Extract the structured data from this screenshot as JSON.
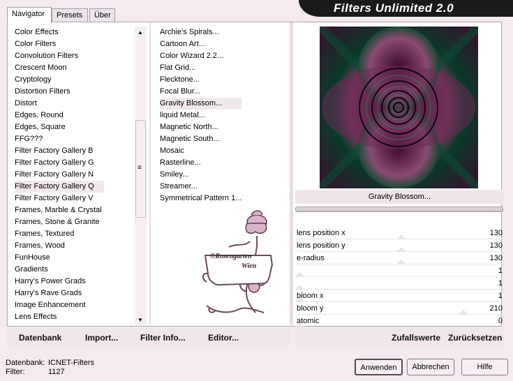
{
  "tabs": [
    {
      "label": "Navigator",
      "active": true
    },
    {
      "label": "Presets",
      "active": false
    },
    {
      "label": "Über",
      "active": false
    }
  ],
  "app_title": "Filters Unlimited 2.0",
  "categories": [
    "Color Effects",
    "Color Filters",
    "Convolution Filters",
    "Crescent Moon",
    "Cryptology",
    "Distortion Filters",
    "Distort",
    "Edges, Round",
    "Edges, Square",
    "FFG???",
    "Filter Factory Gallery B",
    "Filter Factory Gallery G",
    "Filter Factory Gallery N",
    "Filter Factory Gallery Q",
    "Filter Factory Gallery V",
    "Frames, Marble & Crystal",
    "Frames, Stone & Granite",
    "Frames, Textured",
    "Frames, Wood",
    "FunHouse",
    "Gradients",
    "Harry's Power Grads",
    "Harry's Rave Grads",
    "Image Enhancement",
    "Lens Effects"
  ],
  "selected_category": "Filter Factory Gallery Q",
  "filters": [
    "Archie's Spirals...",
    "Cartoon Art...",
    "Color Wizard 2.2...",
    "Flat Grid...",
    "Flecktone...",
    "Focal Blur...",
    "Gravity Blossom...",
    "liquid Metal...",
    "Magnetic North...",
    "Magnetic South...",
    "Mosaic",
    "Rasterline...",
    "Smiley...",
    "Streamer...",
    "Symmetrical Pattern 1..."
  ],
  "selected_filter": "Gravity Blossom...",
  "watermark": {
    "line1": "©Rosengarten",
    "line2": "Wien"
  },
  "preview_name": "Gravity Blossom...",
  "progress": 1.0,
  "params": [
    {
      "label": "lens position x",
      "value": "130",
      "fraction": 0.51
    },
    {
      "label": "lens position y",
      "value": "130",
      "fraction": 0.51
    },
    {
      "label": "e-radius",
      "value": "130",
      "fraction": 0.51
    },
    {
      "label": "",
      "value": "1",
      "fraction": 0.0
    },
    {
      "label": "",
      "value": "1",
      "fraction": 0.0
    },
    {
      "label": "bloom x",
      "value": "1",
      "fraction": 0.0
    },
    {
      "label": "bloom y",
      "value": "210",
      "fraction": 0.82
    },
    {
      "label": "atomic",
      "value": "0",
      "fraction": 0.0
    }
  ],
  "bottom_buttons": {
    "database": "Datenbank",
    "import": "Import...",
    "filter_info": "Filter Info...",
    "editor": "Editor...",
    "random": "Zufallswerte",
    "reset": "Zurücksetzen"
  },
  "status": {
    "db_label": "Datenbank:",
    "db_value": "ICNET-Filters",
    "filter_label": "Filter:",
    "filter_value": "1127"
  },
  "dialog_buttons": {
    "apply": "Anwenden",
    "cancel": "Abbrechen",
    "help": "Hilfe"
  },
  "colors": {
    "background": "#f4eaf0",
    "selection": "#f1e8ee",
    "banner": "#1a1a1a"
  }
}
